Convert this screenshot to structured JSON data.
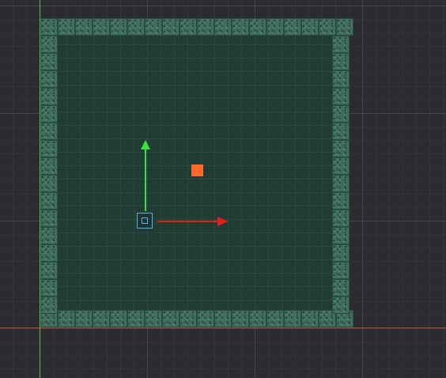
{
  "scene": {
    "background_color": "#2b2b30",
    "grid_color": "#5a5a62",
    "floor_color": "#213b35",
    "wall_tile_color": "#3f6d60",
    "world_origin_axis_x_color": "#c0392b",
    "world_origin_axis_y_color": "#5cc43a",
    "wall_tile_icon": "stone-wall-tile"
  },
  "pickup": {
    "color": "#ff6a2a",
    "icon": "square-marker"
  },
  "gizmo": {
    "x_axis_color": "#e0201a",
    "y_axis_color": "#3fe03a",
    "center_color": "#5aaee0",
    "x_arrow_icon": "arrow-right-icon",
    "y_arrow_icon": "arrow-up-icon",
    "center_icon": "move-handle-icon"
  }
}
